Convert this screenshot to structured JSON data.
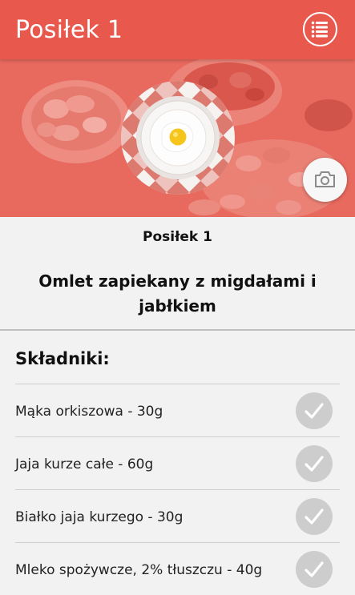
{
  "header": {
    "title": "Posiłek 1",
    "menu_icon": "list-menu-icon"
  },
  "hero": {
    "image": "meal photo: bowls of almonds and dried fruit with a fried egg on a checkered plate",
    "camera_icon": "camera-icon"
  },
  "meal": {
    "label": "Posiłek 1",
    "dish_name": "Omlet zapiekany z migdałami i jabłkiem"
  },
  "ingredients": {
    "heading": "Składniki:",
    "items": [
      {
        "text": "Mąka orkiszowa - 30g",
        "checked": false
      },
      {
        "text": "Jaja kurze całe - 60g",
        "checked": false
      },
      {
        "text": "Białko jaja kurzego - 30g",
        "checked": false
      },
      {
        "text": "Mleko spożywcze, 2% tłuszczu - 40g",
        "checked": false
      }
    ]
  },
  "colors": {
    "accent": "#e9584c",
    "check_inactive": "#cdcdcd",
    "background": "#f2f2f2"
  }
}
